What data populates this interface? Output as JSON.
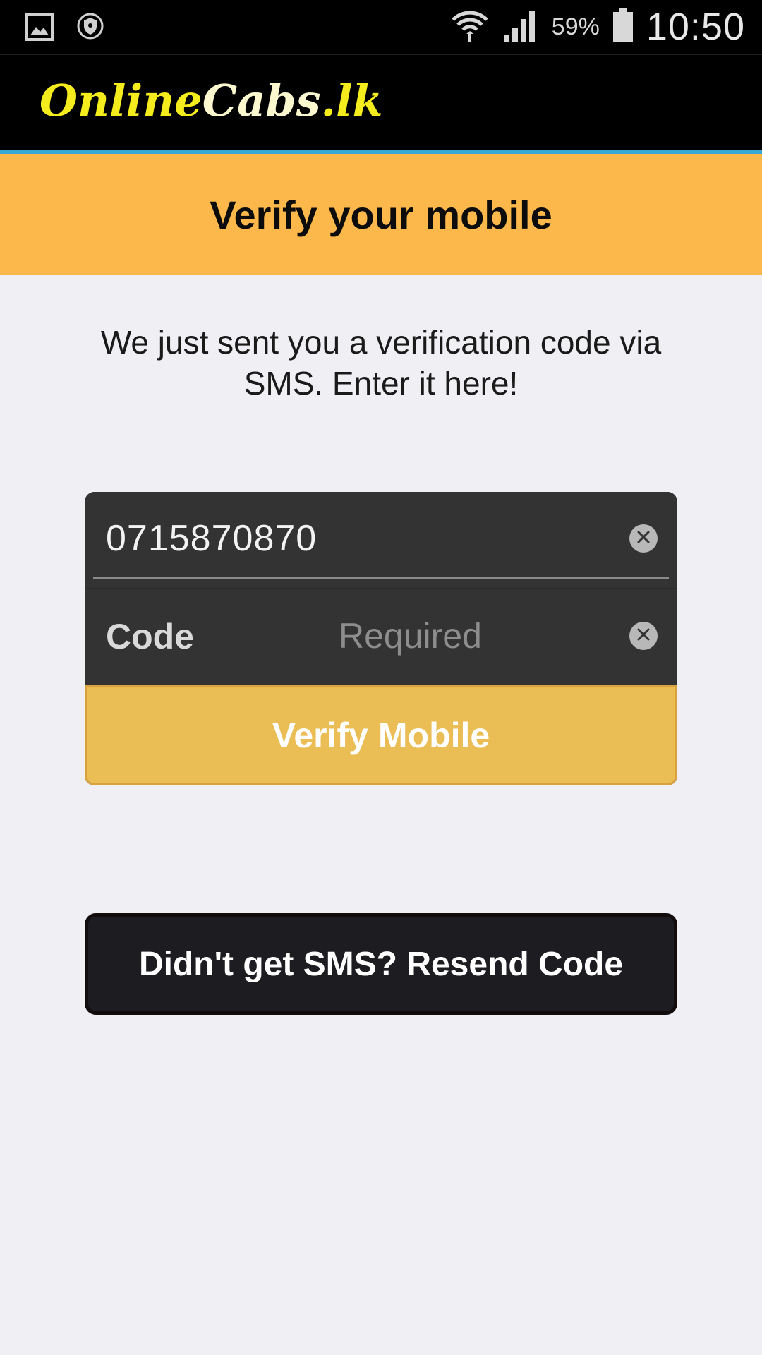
{
  "status_bar": {
    "icons_left": [
      "gallery-icon",
      "vpn-shield-icon"
    ],
    "icons_right": [
      "wifi-icon",
      "signal-icon",
      "battery-icon"
    ],
    "battery_percent": "59%",
    "time": "10:50"
  },
  "header": {
    "logo_part1": "Online",
    "logo_part2": "Cabs",
    "logo_part3": ".lk"
  },
  "banner": {
    "title": "Verify your mobile"
  },
  "instruction": {
    "text": "We just sent you a verification code via SMS. Enter it here!"
  },
  "form": {
    "phone_value": "0715870870",
    "code_label": "Code",
    "code_placeholder": "Required",
    "code_value": "",
    "verify_button_label": "Verify Mobile"
  },
  "resend": {
    "button_label": "Didn't get SMS? Resend Code"
  },
  "colors": {
    "banner": "#fcb84a",
    "header_accent": "#3aa6d2",
    "logo_yellow": "#f4ec1c",
    "verify_button": "#eabd55",
    "resend_button": "#1d1c21",
    "form_card": "#333333",
    "page_background": "#efeff4"
  }
}
